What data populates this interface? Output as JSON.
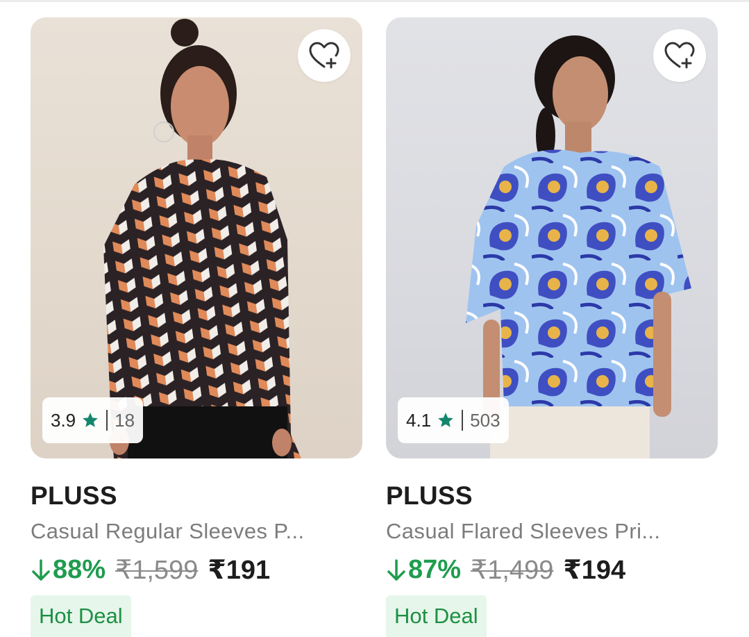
{
  "products": [
    {
      "brand": "PLUSS",
      "title": "Casual Regular Sleeves P...",
      "rating": "3.9",
      "rating_count": "18",
      "discount": "88%",
      "mrp": "₹1,599",
      "price": "₹191",
      "badge": "Hot Deal",
      "wishlist_icon": "heart-plus-icon",
      "rating_icon": "star-icon"
    },
    {
      "brand": "PLUSS",
      "title": "Casual Flared Sleeves Pri...",
      "rating": "4.1",
      "rating_count": "503",
      "discount": "87%",
      "mrp": "₹1,499",
      "price": "₹194",
      "badge": "Hot Deal",
      "wishlist_icon": "heart-plus-icon",
      "rating_icon": "star-icon"
    }
  ],
  "colors": {
    "discount_green": "#1f9c4e",
    "star_green": "#14866e",
    "badge_bg": "#e6f6ea",
    "badge_text": "#1e8f43"
  }
}
